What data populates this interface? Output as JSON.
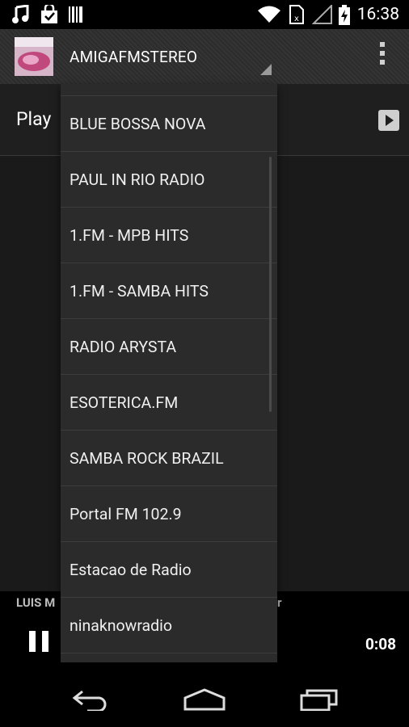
{
  "statusbar": {
    "time": "16:38",
    "icons": [
      "music-note-icon",
      "shopping-bag-icon",
      "barcode-icon",
      "wifi-icon",
      "sim-icon",
      "signal-icon",
      "battery-charging-icon"
    ]
  },
  "actionbar": {
    "title": "AMIGAFMSTEREO"
  },
  "content": {
    "play_label": "Play"
  },
  "dropdown": {
    "items": [
      "BLUE BOSSA NOVA",
      "PAUL IN RIO RADIO",
      "1.FM - MPB HITS",
      "1.FM - SAMBA HITS",
      "RADIO ARYSTA",
      "ESOTERICA.FM",
      "SAMBA ROCK BRAZIL",
      "Portal FM 102.9",
      "Estacao de Radio",
      "ninaknowradio"
    ]
  },
  "nowplaying": {
    "title_left": "LUIS M",
    "title_right": "r",
    "time": "0:08"
  },
  "navbar": {
    "icons": [
      "back-icon",
      "home-icon",
      "recents-icon"
    ]
  }
}
